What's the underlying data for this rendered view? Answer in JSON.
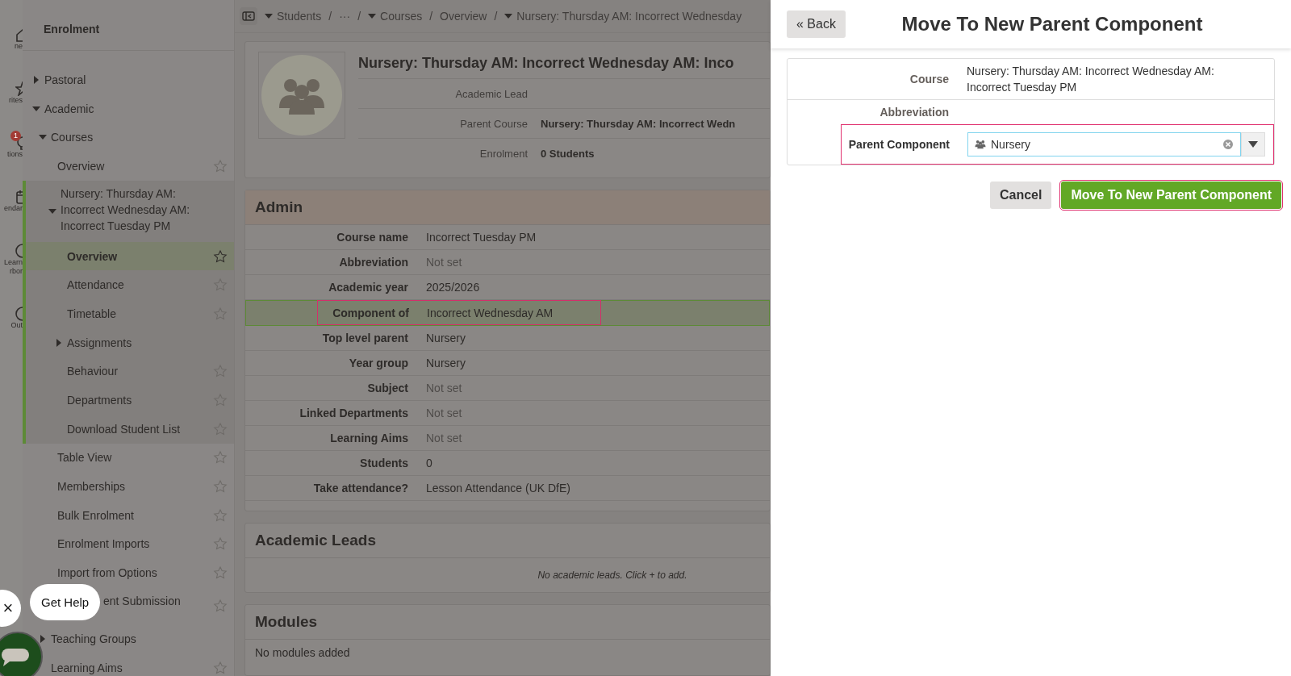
{
  "rail": [
    {
      "label": "ne"
    },
    {
      "label": "rites"
    },
    {
      "label": "tions",
      "badge": "1"
    },
    {
      "label": "endar"
    },
    {
      "label": "Learn",
      "label2": "rbor"
    },
    {
      "label": "Out"
    }
  ],
  "sidebar": {
    "title": "Enrolment",
    "items": [
      {
        "label": "Pastoral",
        "expanded": false
      },
      {
        "label": "Academic",
        "expanded": true,
        "children": [
          {
            "label": "Courses",
            "expanded": true,
            "children": [
              {
                "label": "Overview",
                "favorite": true,
                "selected": false
              },
              {
                "label": "Nursery: Thursday AM: Incorrect Wednesday AM: Incorrect Tuesday PM",
                "expanded": true,
                "current": true,
                "children": [
                  {
                    "label": "Overview",
                    "favorite": true,
                    "selected": true
                  },
                  {
                    "label": "Attendance",
                    "favorite": true,
                    "selected": false
                  },
                  {
                    "label": "Timetable",
                    "favorite": true,
                    "selected": false
                  },
                  {
                    "label": "Assignments",
                    "expanded": false
                  },
                  {
                    "label": "Behaviour",
                    "favorite": true,
                    "selected": false
                  },
                  {
                    "label": "Departments",
                    "favorite": true,
                    "selected": false
                  },
                  {
                    "label": "Download Student List",
                    "favorite": true,
                    "selected": false
                  }
                ]
              },
              {
                "label": "Table View",
                "favorite": true,
                "selected": false
              },
              {
                "label": "Memberships",
                "favorite": true,
                "selected": false
              },
              {
                "label": "Bulk Enrolment",
                "favorite": true,
                "selected": false
              },
              {
                "label": "Enrolment Imports",
                "favorite": true,
                "selected": false
              },
              {
                "label": "Import from Options",
                "favorite": true,
                "selected": false
              },
              {
                "label": "ent Submission",
                "favorite": true,
                "selected": false,
                "covered_by_help": true
              }
            ]
          },
          {
            "label": "Teaching Groups",
            "expanded": false
          },
          {
            "label": "Learning Aims",
            "favorite": true,
            "selected": false
          }
        ]
      }
    ]
  },
  "breadcrumb": [
    {
      "label": "Students",
      "kind": "link",
      "dropdown": true
    },
    {
      "label": "/",
      "kind": "separator"
    },
    {
      "label": "···",
      "kind": "link",
      "dropdown": false
    },
    {
      "label": "/",
      "kind": "separator"
    },
    {
      "label": "Courses",
      "kind": "link",
      "dropdown": true
    },
    {
      "label": "/",
      "kind": "separator"
    },
    {
      "label": "Overview",
      "kind": "link",
      "dropdown": false
    },
    {
      "label": "/",
      "kind": "separator"
    },
    {
      "label": "Nursery: Thursday AM: Incorrect Wednesday",
      "kind": "link",
      "dropdown": true
    }
  ],
  "course_header": {
    "title": "Nursery: Thursday AM: Incorrect Wednesday AM: Inco",
    "fields": [
      {
        "label": "Academic Lead"
      },
      {
        "label": "Parent Course",
        "value": "Nursery: Thursday AM: Incorrect Wedn"
      },
      {
        "label": "Enrolment",
        "value": "0 Students"
      }
    ]
  },
  "admin": {
    "title": "Admin",
    "rows": [
      {
        "label": "Course name",
        "value": "Incorrect Tuesday PM",
        "unset": false,
        "highlighted": false
      },
      {
        "label": "Abbreviation",
        "value": "Not set",
        "unset": true,
        "highlighted": false
      },
      {
        "label": "Academic year",
        "value": "2025/2026",
        "unset": false,
        "highlighted": false
      },
      {
        "label": "Component of",
        "value": "Incorrect Wednesday AM",
        "unset": false,
        "highlighted": true
      },
      {
        "label": "Top level parent",
        "value": "Nursery",
        "unset": false,
        "highlighted": false
      },
      {
        "label": "Year group",
        "value": "Nursery",
        "unset": false,
        "highlighted": false
      },
      {
        "label": "Subject",
        "value": "Not set",
        "unset": true,
        "highlighted": false
      },
      {
        "label": "Linked Departments",
        "value": "Not set",
        "unset": true,
        "highlighted": false
      },
      {
        "label": "Learning Aims",
        "value": "Not set",
        "unset": true,
        "highlighted": false
      },
      {
        "label": "Students",
        "value": "0",
        "unset": false,
        "highlighted": false
      },
      {
        "label": "Take attendance?",
        "value": "Lesson Attendance (UK DfE)",
        "unset": false,
        "highlighted": false
      }
    ]
  },
  "academic_leads": {
    "title": "Academic Leads",
    "empty_text": "No academic leads. Click + to add."
  },
  "modules": {
    "title": "Modules",
    "empty_text": "No modules added"
  },
  "help": {
    "label": "Get Help",
    "close": "×"
  },
  "drawer": {
    "back": "« Back",
    "title": "Move To New Parent Component",
    "fields": [
      {
        "label": "Course",
        "value": "Nursery: Thursday AM: Incorrect Wednesday AM: Incorrect Tuesday PM",
        "kind": "text"
      },
      {
        "label": "Abbreviation",
        "kind": "text"
      },
      {
        "label": "Parent Component",
        "value": "Nursery",
        "kind": "select",
        "highlighted": true
      }
    ],
    "cancel": "Cancel",
    "submit": {
      "label": "Move To New Parent Component",
      "highlighted": true
    }
  }
}
